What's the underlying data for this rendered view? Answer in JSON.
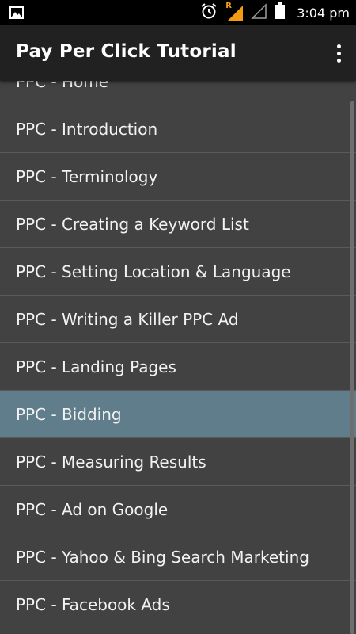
{
  "status_bar": {
    "time": "3:04 pm",
    "icons": [
      "image-notification-icon",
      "alarm-icon",
      "roaming-signal-icon",
      "signal-icon",
      "battery-icon"
    ],
    "roaming_label": "R"
  },
  "app_bar": {
    "title": "Pay Per Click Tutorial",
    "overflow_icon": "more-vert-icon"
  },
  "list": {
    "items": [
      "PPC - Home",
      "PPC - Introduction",
      "PPC - Terminology",
      "PPC - Creating a Keyword List",
      "PPC - Setting Location & Language",
      "PPC - Writing a Killer PPC Ad",
      "PPC - Landing Pages",
      "PPC - Bidding",
      "PPC - Measuring Results",
      "PPC - Ad on Google",
      "PPC - Yahoo & Bing Search Marketing",
      "PPC - Facebook Ads"
    ],
    "selected_index": 7
  },
  "colors": {
    "background": "#424242",
    "app_bar": "#212121",
    "selected": "#607d8b",
    "status_bar": "#000000",
    "roaming_accent": "#f39c12"
  }
}
